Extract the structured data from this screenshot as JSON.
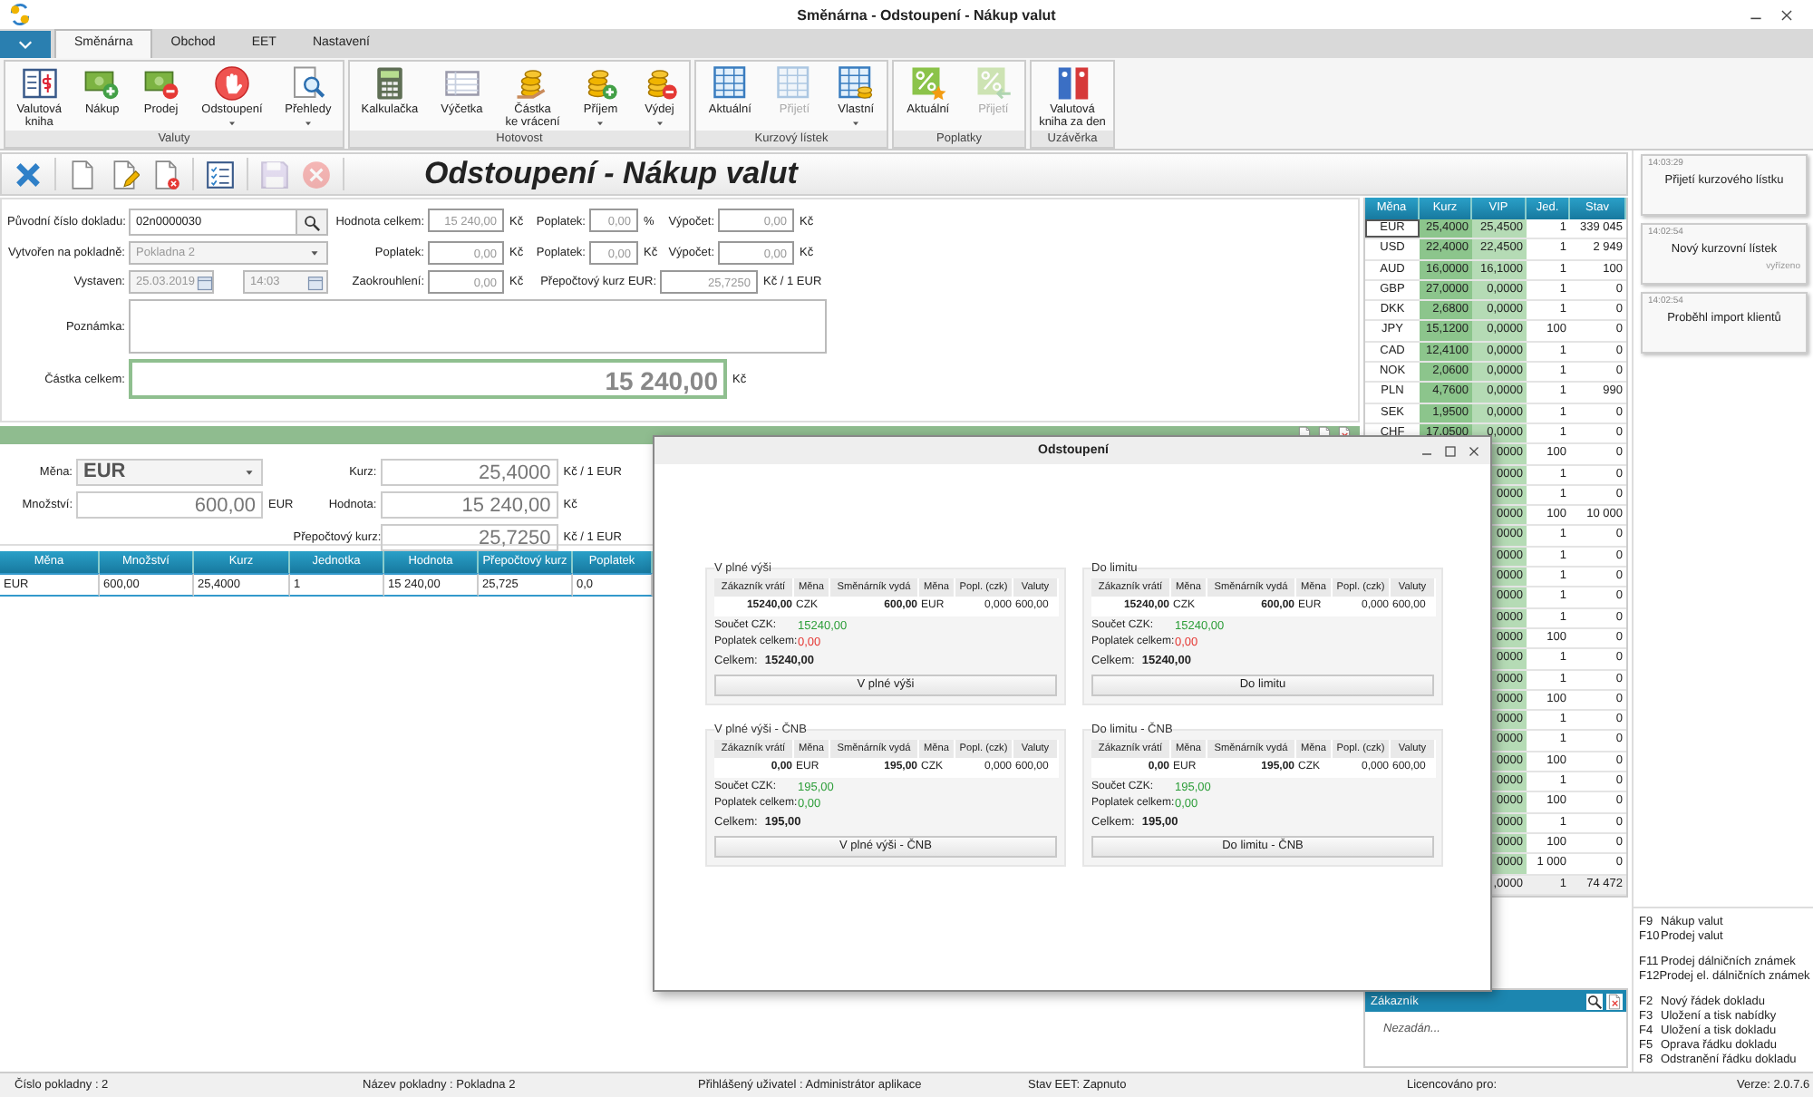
{
  "window": {
    "title": "Směnárna - Odstoupení - Nákup valut"
  },
  "tabs": [
    {
      "label": "Směnárna",
      "selected": true
    },
    {
      "label": "Obchod",
      "selected": false
    },
    {
      "label": "EET",
      "selected": false
    },
    {
      "label": "Nastavení",
      "selected": false
    }
  ],
  "ribbon": [
    {
      "label": "Valuty",
      "buttons": [
        {
          "kind": "book",
          "label": "Valutová\nkniha",
          "dropdown": false,
          "disabled": false
        },
        {
          "kind": "cash_in",
          "label": "Nákup",
          "dropdown": false,
          "disabled": false
        },
        {
          "kind": "cash_out",
          "label": "Prodej",
          "dropdown": false,
          "disabled": false
        },
        {
          "kind": "stop",
          "label": "Odstoupení",
          "dropdown": true,
          "disabled": false
        },
        {
          "kind": "overview",
          "label": "Přehledy",
          "dropdown": true,
          "disabled": false
        }
      ]
    },
    {
      "label": "Hotovost",
      "buttons": [
        {
          "kind": "calculator",
          "label": "Kalkulačka",
          "dropdown": false,
          "disabled": false
        },
        {
          "kind": "tally",
          "label": "Výčetka",
          "dropdown": false,
          "disabled": false
        },
        {
          "kind": "change",
          "label": "Částka\nke vrácení",
          "dropdown": false,
          "disabled": false
        },
        {
          "kind": "income",
          "label": "Příjem",
          "dropdown": true,
          "disabled": false
        },
        {
          "kind": "expense",
          "label": "Výdej",
          "dropdown": true,
          "disabled": false
        }
      ]
    },
    {
      "label": "Kurzový lístek",
      "buttons": [
        {
          "kind": "rates",
          "label": "Aktuální",
          "dropdown": false,
          "disabled": false
        },
        {
          "kind": "rates",
          "label": "Přijetí",
          "dropdown": false,
          "disabled": true
        },
        {
          "kind": "rates_own",
          "label": "Vlastní",
          "dropdown": true,
          "disabled": false
        }
      ]
    },
    {
      "label": "Poplatky",
      "buttons": [
        {
          "kind": "fee",
          "label": "Aktuální",
          "dropdown": false,
          "disabled": false
        },
        {
          "kind": "fee_in",
          "label": "Přijetí",
          "dropdown": false,
          "disabled": true
        }
      ]
    },
    {
      "label": "Uzávěrka",
      "buttons": [
        {
          "kind": "binders",
          "label": "Valutová\nkniha za den",
          "dropdown": false,
          "disabled": false
        }
      ]
    }
  ],
  "toolbar": {
    "title": "Odstoupení - Nákup valut",
    "tool_groups": [
      [
        {
          "kind": "close",
          "disabled": false
        }
      ],
      [
        {
          "kind": "new",
          "disabled": false
        },
        {
          "kind": "edit",
          "disabled": false
        },
        {
          "kind": "delete",
          "disabled": false
        }
      ],
      [
        {
          "kind": "list",
          "disabled": false
        }
      ],
      [
        {
          "kind": "save",
          "disabled": true
        },
        {
          "kind": "cancel",
          "disabled": true
        }
      ]
    ]
  },
  "document": {
    "original_number": {
      "label": "Původní číslo dokladu:",
      "value": "02n0000030"
    },
    "register": {
      "label": "Vytvořen na pokladně:",
      "value": "Pokladna 2"
    },
    "issued": {
      "label": "Vystaven:",
      "date": "25.03.2019",
      "time": "14:03"
    },
    "note": {
      "label": "Poznámka:"
    },
    "total": {
      "label": "Částka celkem:",
      "value": "15 240,00",
      "unit": "Kč"
    },
    "summary": [
      [
        {
          "label": "Hodnota celkem:",
          "value": "15 240,00",
          "unit": "Kč"
        },
        {
          "label": "Poplatek:",
          "value": "0,00",
          "unit": "%"
        },
        {
          "label": "Výpočet:",
          "value": "0,00",
          "unit": "Kč"
        }
      ],
      [
        {
          "label": "Poplatek:",
          "value": "0,00",
          "unit": "Kč"
        },
        {
          "label": "Poplatek:",
          "value": "0,00",
          "unit": "Kč"
        },
        {
          "label": "Výpočet:",
          "value": "0,00",
          "unit": "Kč"
        }
      ],
      [
        {
          "label": "Zaokrouhlení:",
          "value": "0,00",
          "unit": "Kč"
        },
        {
          "label": "Přepočtový kurz EUR:",
          "value": "25,7250",
          "unit": "Kč / 1 EUR"
        }
      ]
    ]
  },
  "line": {
    "left": [
      {
        "kind": "select",
        "label": "Měna:",
        "value": "EUR"
      },
      {
        "kind": "amount",
        "label": "Množství:",
        "value": "600,00",
        "unit": "EUR"
      }
    ],
    "right": [
      {
        "label": "Kurz:",
        "value": "25,4000",
        "unit": "Kč / 1 EUR"
      },
      {
        "label": "Hodnota:",
        "value": "15 240,00",
        "unit": "Kč"
      },
      {
        "label": "Přepočtový kurz:",
        "value": "25,7250",
        "unit": "Kč / 1 EUR"
      }
    ]
  },
  "items": {
    "columns": [
      "Měna",
      "Množství",
      "Kurz",
      "Jednotka",
      "Hodnota",
      "Přepočtový kurz",
      "Poplatek"
    ],
    "rows": [
      {
        "selected": true,
        "cells": [
          "EUR",
          "600,00",
          "25,4000",
          "1",
          "15 240,00",
          "25,725",
          "0,0"
        ]
      }
    ]
  },
  "rates": {
    "columns": [
      "Měna",
      "Kurz",
      "VIP",
      "Jed.",
      "Stav"
    ],
    "rows": [
      {
        "currency": "EUR",
        "rate": "25,4000",
        "vip": "25,4500",
        "unit": "1",
        "balance": "339 045",
        "selected": true
      },
      {
        "currency": "USD",
        "rate": "22,4000",
        "vip": "22,4500",
        "unit": "1",
        "balance": "2 949",
        "selected": false
      },
      {
        "currency": "AUD",
        "rate": "16,0000",
        "vip": "16,1000",
        "unit": "1",
        "balance": "100",
        "selected": false
      },
      {
        "currency": "GBP",
        "rate": "27,0000",
        "vip": "0,0000",
        "unit": "1",
        "balance": "0",
        "selected": false
      },
      {
        "currency": "DKK",
        "rate": "2,6800",
        "vip": "0,0000",
        "unit": "1",
        "balance": "0",
        "selected": false
      },
      {
        "currency": "JPY",
        "rate": "15,1200",
        "vip": "0,0000",
        "unit": "100",
        "balance": "0",
        "selected": false
      },
      {
        "currency": "CAD",
        "rate": "12,4100",
        "vip": "0,0000",
        "unit": "1",
        "balance": "0",
        "selected": false
      },
      {
        "currency": "NOK",
        "rate": "2,0600",
        "vip": "0,0000",
        "unit": "1",
        "balance": "0",
        "selected": false
      },
      {
        "currency": "PLN",
        "rate": "4,7600",
        "vip": "0,0000",
        "unit": "1",
        "balance": "990",
        "selected": false
      },
      {
        "currency": "SEK",
        "rate": "1,9500",
        "vip": "0,0000",
        "unit": "1",
        "balance": "0",
        "selected": false
      },
      {
        "currency": "CHF",
        "rate": "17,0500",
        "vip": "0,0000",
        "unit": "1",
        "balance": "0",
        "selected": false
      },
      {
        "vip": "0000",
        "unit": "100",
        "balance": "0",
        "selected": false
      },
      {
        "vip": "0000",
        "unit": "1",
        "balance": "0",
        "selected": false
      },
      {
        "vip": "0000",
        "unit": "1",
        "balance": "0",
        "selected": false
      },
      {
        "vip": "0000",
        "unit": "100",
        "balance": "10 000",
        "selected": false
      },
      {
        "vip": "0000",
        "unit": "1",
        "balance": "0",
        "selected": false
      },
      {
        "vip": "0000",
        "unit": "1",
        "balance": "0",
        "selected": false
      },
      {
        "vip": "0000",
        "unit": "1",
        "balance": "0",
        "selected": false
      },
      {
        "vip": "0000",
        "unit": "1",
        "balance": "0",
        "selected": false
      },
      {
        "vip": "0000",
        "unit": "1",
        "balance": "0",
        "selected": false
      },
      {
        "vip": "0000",
        "unit": "100",
        "balance": "0",
        "selected": false
      },
      {
        "vip": "0000",
        "unit": "1",
        "balance": "0",
        "selected": false
      },
      {
        "vip": "0000",
        "unit": "1",
        "balance": "0",
        "selected": false
      },
      {
        "vip": "0000",
        "unit": "100",
        "balance": "0",
        "selected": false
      },
      {
        "vip": "0000",
        "unit": "1",
        "balance": "0",
        "selected": false
      },
      {
        "vip": "0000",
        "unit": "1",
        "balance": "0",
        "selected": false
      },
      {
        "vip": "0000",
        "unit": "100",
        "balance": "0",
        "selected": false
      },
      {
        "vip": "0000",
        "unit": "1",
        "balance": "0",
        "selected": false
      },
      {
        "vip": "0000",
        "unit": "100",
        "balance": "0",
        "selected": false
      },
      {
        "vip": "0000",
        "unit": "1",
        "balance": "0",
        "selected": false
      },
      {
        "vip": "0000",
        "unit": "100",
        "balance": "0",
        "selected": false
      },
      {
        "vip": "0000",
        "unit": "1 000",
        "balance": "0",
        "selected": false
      },
      {
        "vip": ",0000",
        "unit": "1",
        "balance": "74 472",
        "selected": false
      }
    ]
  },
  "customer": {
    "title": "Zákazník",
    "value": "Nezadán..."
  },
  "notifications": [
    {
      "time": "14:03:29",
      "text": "Přijetí kurzového lístku"
    },
    {
      "time": "14:02:54",
      "text": "Nový kurzovní lístek",
      "note": "vyřízeno"
    },
    {
      "time": "14:02:54",
      "text": "Proběhl import klientů"
    }
  ],
  "shortcuts": [
    [
      {
        "key": "F9",
        "text": "Nákup valut"
      },
      {
        "key": "F10",
        "text": "Prodej valut"
      }
    ],
    [
      {
        "key": "F11",
        "text": "Prodej dálničních známek"
      },
      {
        "key": "F12",
        "text": "Prodej el. dálničních známek"
      }
    ],
    [
      {
        "key": "F2",
        "text": "Nový řádek dokladu"
      },
      {
        "key": "F3",
        "text": "Uložení a tisk nabídky"
      },
      {
        "key": "F4",
        "text": "Uložení a tisk dokladu"
      },
      {
        "key": "F5",
        "text": "Oprava řádku dokladu"
      },
      {
        "key": "F8",
        "text": "Odstranění řádku dokladu"
      }
    ]
  ],
  "dialog": {
    "title": "Odstoupení",
    "options": [
      {
        "title": "V plné výši",
        "columns": [
          "Zákazník vrátí",
          "Měna",
          "Směnárník vydá",
          "Měna",
          "Popl. (czk)",
          "Valuty"
        ],
        "values": [
          "15240,00",
          "CZK",
          "600,00",
          "EUR",
          "0,000",
          "600,00"
        ],
        "sums": [
          {
            "label": "Součet CZK:",
            "value": "15240,00",
            "color": "#2e9e3a"
          },
          {
            "label": "Poplatek celkem:",
            "value": "0,00",
            "color": "#e53935"
          }
        ],
        "total": {
          "label": "Celkem:",
          "value": "15240,00"
        },
        "button": "V plné výši"
      },
      {
        "title": "Do limitu",
        "columns": [
          "Zákazník vrátí",
          "Měna",
          "Směnárník vydá",
          "Měna",
          "Popl. (czk)",
          "Valuty"
        ],
        "values": [
          "15240,00",
          "CZK",
          "600,00",
          "EUR",
          "0,000",
          "600,00"
        ],
        "sums": [
          {
            "label": "Součet CZK:",
            "value": "15240,00",
            "color": "#2e9e3a"
          },
          {
            "label": "Poplatek celkem:",
            "value": "0,00",
            "color": "#e53935"
          }
        ],
        "total": {
          "label": "Celkem:",
          "value": "15240,00"
        },
        "button": "Do limitu"
      },
      {
        "title": "V plné výši - ČNB",
        "columns": [
          "Zákazník vrátí",
          "Měna",
          "Směnárník vydá",
          "Měna",
          "Popl. (czk)",
          "Valuty"
        ],
        "values": [
          "0,00",
          "EUR",
          "195,00",
          "CZK",
          "0,000",
          "600,00"
        ],
        "sums": [
          {
            "label": "Součet CZK:",
            "value": "195,00",
            "color": "#2e9e3a"
          },
          {
            "label": "Poplatek celkem:",
            "value": "0,00",
            "color": "#2e9e3a"
          }
        ],
        "total": {
          "label": "Celkem:",
          "value": "195,00"
        },
        "button": "V plné výši - ČNB"
      },
      {
        "title": "Do limitu - ČNB",
        "columns": [
          "Zákazník vrátí",
          "Měna",
          "Směnárník vydá",
          "Měna",
          "Popl. (czk)",
          "Valuty"
        ],
        "values": [
          "0,00",
          "EUR",
          "195,00",
          "CZK",
          "0,000",
          "600,00"
        ],
        "sums": [
          {
            "label": "Součet CZK:",
            "value": "195,00",
            "color": "#2e9e3a"
          },
          {
            "label": "Poplatek celkem:",
            "value": "0,00",
            "color": "#2e9e3a"
          }
        ],
        "total": {
          "label": "Celkem:",
          "value": "195,00"
        },
        "button": "Do limitu - ČNB"
      }
    ]
  },
  "status_bar": [
    "Číslo pokladny : 2",
    "Název pokladny : Pokladna 2",
    "Přihlášený uživatel : Administrátor aplikace",
    "Stav EET: Zapnuto",
    "Licencováno pro:",
    "Verze: 2.0.7.6"
  ]
}
